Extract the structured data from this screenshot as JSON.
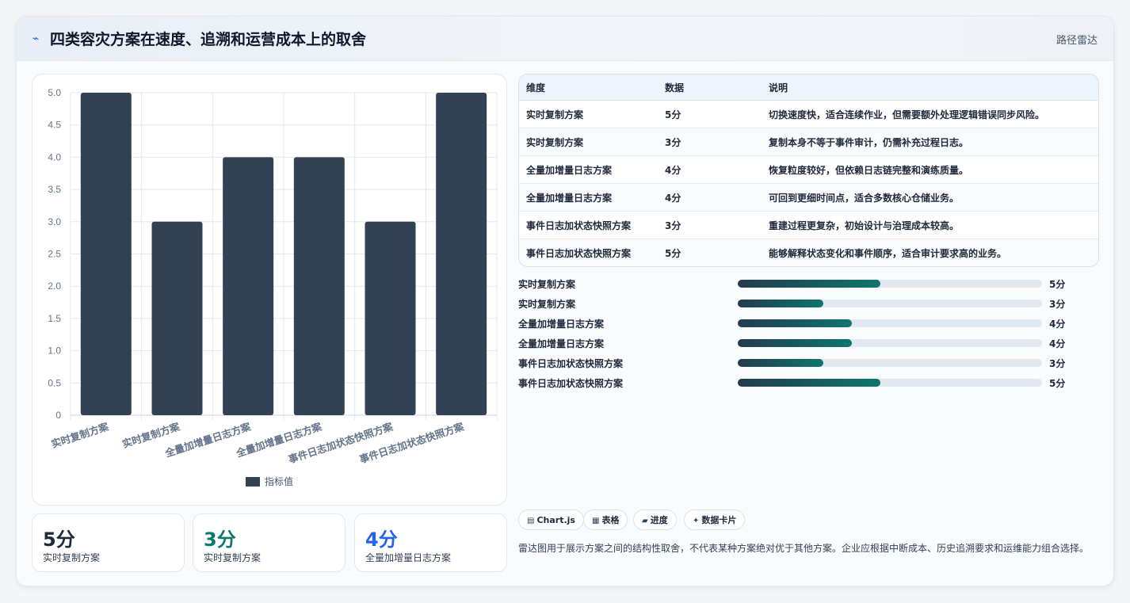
{
  "header": {
    "icon": "pulse-icon",
    "title": "四类容灾方案在速度、追溯和运营成本上的取舍",
    "tag": "路径雷达"
  },
  "chart_data": {
    "type": "bar",
    "categories": [
      "实时复制方案",
      "实时复制方案",
      "全量加增量日志方案",
      "全量加增量日志方案",
      "事件日志加状态快照方案",
      "事件日志加状态快照方案"
    ],
    "series": [
      {
        "name": "指标值",
        "values": [
          5,
          3,
          4,
          4,
          3,
          5
        ]
      }
    ],
    "ylim": [
      0,
      5
    ],
    "yticks": [
      "0",
      "0.5",
      "1.0",
      "1.5",
      "2.0",
      "2.5",
      "3.0",
      "3.5",
      "4.0",
      "4.5",
      "5.0"
    ],
    "grid": true,
    "legend": "bottom",
    "colors": {
      "bar": "#334155",
      "grid": "#e5e7eb",
      "axis_text": "#64748b"
    }
  },
  "stats": [
    {
      "value": "5分",
      "label": "实时复制方案",
      "color": "#1e293b"
    },
    {
      "value": "3分",
      "label": "实时复制方案",
      "color": "#0f766e"
    },
    {
      "value": "4分",
      "label": "全量加增量日志方案",
      "color": "#2563eb"
    }
  ],
  "table": {
    "headers": [
      "维度",
      "数据",
      "说明"
    ],
    "rows": [
      [
        "实时复制方案",
        "5分",
        "切换速度快，适合连续作业，但需要额外处理逻辑错误同步风险。"
      ],
      [
        "实时复制方案",
        "3分",
        "复制本身不等于事件审计，仍需补充过程日志。"
      ],
      [
        "全量加增量日志方案",
        "4分",
        "恢复粒度较好，但依赖日志链完整和演练质量。"
      ],
      [
        "全量加增量日志方案",
        "4分",
        "可回到更细时间点，适合多数核心仓储业务。"
      ],
      [
        "事件日志加状态快照方案",
        "3分",
        "重建过程更复杂，初始设计与治理成本较高。"
      ],
      [
        "事件日志加状态快照方案",
        "5分",
        "能够解释状态变化和事件顺序，适合审计要求高的业务。"
      ]
    ]
  },
  "progress": [
    {
      "label": "实时复制方案",
      "value": "5分",
      "fraction": 0.47
    },
    {
      "label": "实时复制方案",
      "value": "3分",
      "fraction": 0.28
    },
    {
      "label": "全量加增量日志方案",
      "value": "4分",
      "fraction": 0.375
    },
    {
      "label": "全量加增量日志方案",
      "value": "4分",
      "fraction": 0.375
    },
    {
      "label": "事件日志加状态快照方案",
      "value": "3分",
      "fraction": 0.28
    },
    {
      "label": "事件日志加状态快照方案",
      "value": "5分",
      "fraction": 0.47
    }
  ],
  "chips": [
    {
      "icon": "chart-icon",
      "glyph": "▤",
      "label": "Chart.js"
    },
    {
      "icon": "table-icon",
      "glyph": "▦",
      "label": "表格"
    },
    {
      "icon": "progress-icon",
      "glyph": "▰",
      "label": "进度"
    },
    {
      "icon": "sparkle-icon",
      "glyph": "✦",
      "label": "数据卡片"
    }
  ],
  "note": "雷达图用于展示方案之间的结构性取舍，不代表某种方案绝对优于其他方案。企业应根据中断成本、历史追溯要求和运维能力组合选择。"
}
